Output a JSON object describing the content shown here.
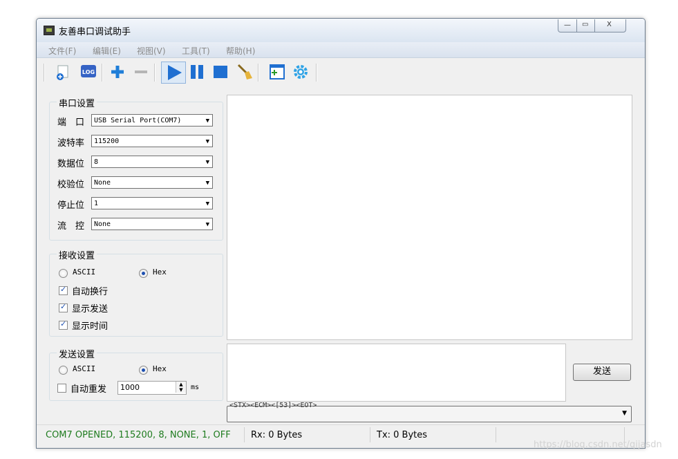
{
  "window": {
    "title": "友善串口调试助手",
    "controls": {
      "minimize": "—",
      "maximize": "▭",
      "close": "X"
    }
  },
  "menu": [
    "文件(F)",
    "编辑(E)",
    "视图(V)",
    "工具(T)",
    "帮助(H)"
  ],
  "toolbar": {
    "icons": [
      "new-file-icon",
      "log-icon",
      "add-icon",
      "remove-icon",
      "play-icon",
      "pause-icon",
      "stop-icon",
      "clear-brush-icon",
      "add-window-icon",
      "settings-gear-icon"
    ],
    "log_text": "LOG"
  },
  "serial": {
    "title": "串口设置",
    "rows": [
      {
        "label": "端　口",
        "value": "USB Serial Port(COM7)"
      },
      {
        "label": "波特率",
        "value": "115200"
      },
      {
        "label": "数据位",
        "value": "8"
      },
      {
        "label": "校验位",
        "value": "None"
      },
      {
        "label": "停止位",
        "value": "1"
      },
      {
        "label": "流　控",
        "value": "None"
      }
    ]
  },
  "receive": {
    "title": "接收设置",
    "ascii": "ASCII",
    "hex": "Hex",
    "selected": "Hex",
    "options": [
      {
        "label": "自动换行",
        "checked": true
      },
      {
        "label": "显示发送",
        "checked": true
      },
      {
        "label": "显示时间",
        "checked": true
      }
    ]
  },
  "send": {
    "title": "发送设置",
    "ascii": "ASCII",
    "hex": "Hex",
    "selected": "Hex",
    "auto_resend": {
      "label": "自动重发",
      "checked": false
    },
    "interval": "1000",
    "unit": "ms",
    "send_button": "发送"
  },
  "history": {
    "text": "<STX><ECM><[53]><EOT>"
  },
  "status": {
    "port": "COM7 OPENED, 115200, 8, NONE, 1, OFF",
    "rx": "Rx: 0 Bytes",
    "tx": "Tx: 0 Bytes"
  },
  "colors": {
    "status_green": "#1e7b1e",
    "accent_blue": "#1f6fd1"
  },
  "watermark": "https://blog.csdn.net/qijasdn"
}
